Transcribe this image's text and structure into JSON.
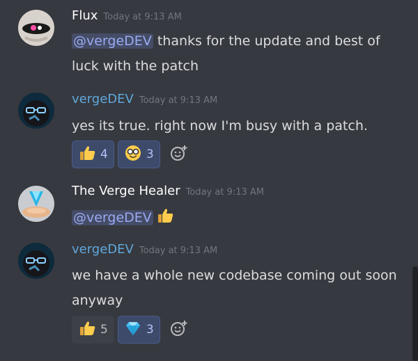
{
  "messages": [
    {
      "author": "Flux",
      "author_color": "#ffffff",
      "timestamp": "Today at 9:13 AM",
      "mention": "@vergeDEV",
      "text": " thanks for the update and best of luck with the patch"
    },
    {
      "author": "vergeDEV",
      "author_color": "#5fa8dd",
      "timestamp": "Today at 9:13 AM",
      "text": "yes its true. right now I'm busy with a patch.",
      "reactions": [
        {
          "emoji": "thumbs-up",
          "count": "4",
          "selected": true
        },
        {
          "emoji": "nerd-face",
          "count": "3",
          "selected": true
        }
      ]
    },
    {
      "author": "The Verge Healer",
      "author_color": "#ffffff",
      "timestamp": "Today at 9:13 AM",
      "mention": "@vergeDEV",
      "inline_emoji": "thumbs-up"
    },
    {
      "author": "vergeDEV",
      "author_color": "#5fa8dd",
      "timestamp": "Today at 9:13 AM",
      "text": "we have a whole new codebase coming out soon anyway",
      "reactions": [
        {
          "emoji": "thumbs-up",
          "count": "5",
          "selected": false
        },
        {
          "emoji": "gem",
          "count": "3",
          "selected": true
        }
      ]
    }
  ]
}
